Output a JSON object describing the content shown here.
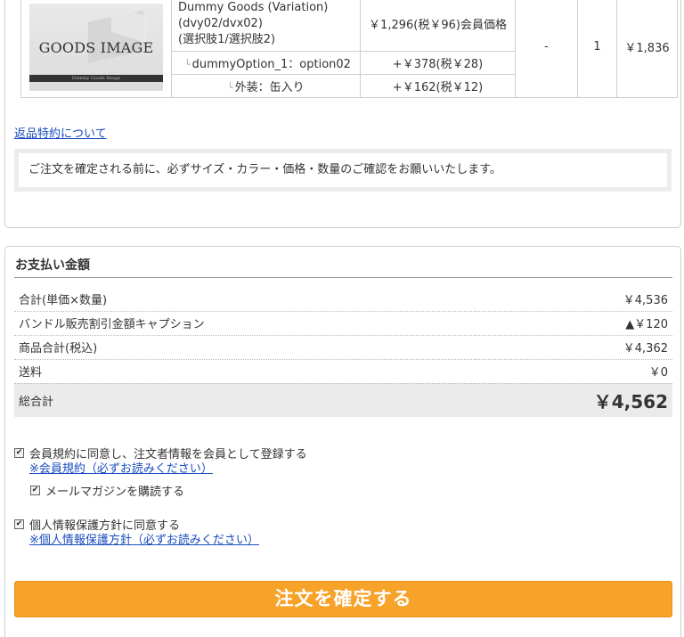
{
  "cart": {
    "item": {
      "image_text": "GOODS IMAGE",
      "image_caption": "Dummy Goods Image",
      "name_lines": [
        "Dummy Goods (Variation)",
        "(dvy02/dvx02)",
        "(選択肢1/選択肢2)"
      ],
      "price": "￥1,296(税￥96)会員価格",
      "discount": "-",
      "quantity": "1",
      "subtotal": "￥1,836",
      "options": [
        {
          "name": "dummyOption_1：option02",
          "price": "+￥378(税￥28)"
        },
        {
          "name": "外装：缶入り",
          "price": "+￥162(税￥12)"
        }
      ]
    },
    "returns_link": "返品特約について",
    "notice": "ご注文を確定される前に、必ずサイズ・カラー・価格・数量のご確認をお願いいたします。"
  },
  "payment": {
    "title": "お支払い金額",
    "rows": [
      {
        "label": "合計(単価×数量)",
        "value": "￥4,536"
      },
      {
        "label": "バンドル販売割引金額キャプション",
        "value": "▲￥120"
      },
      {
        "label": "商品合計(税込)",
        "value": "￥4,362"
      },
      {
        "label": "送料",
        "value": "￥0"
      }
    ],
    "total": {
      "label": "総合計",
      "value": "￥4,562"
    }
  },
  "agreements": {
    "member": {
      "label": "会員規約に同意し、注文者情報を会員として登録する",
      "link": "※会員規約（必ずお読みください）",
      "checked": true
    },
    "newsletter": {
      "label": "メールマガジンを購読する",
      "checked": true
    },
    "privacy": {
      "label": "個人情報保護方針に同意する",
      "link": "※個人情報保護方針（必ずお読みください）",
      "checked": true
    }
  },
  "confirm_button": "注文を確定する",
  "colors": {
    "accent": "#f7a229",
    "link": "#1a4dbf"
  }
}
